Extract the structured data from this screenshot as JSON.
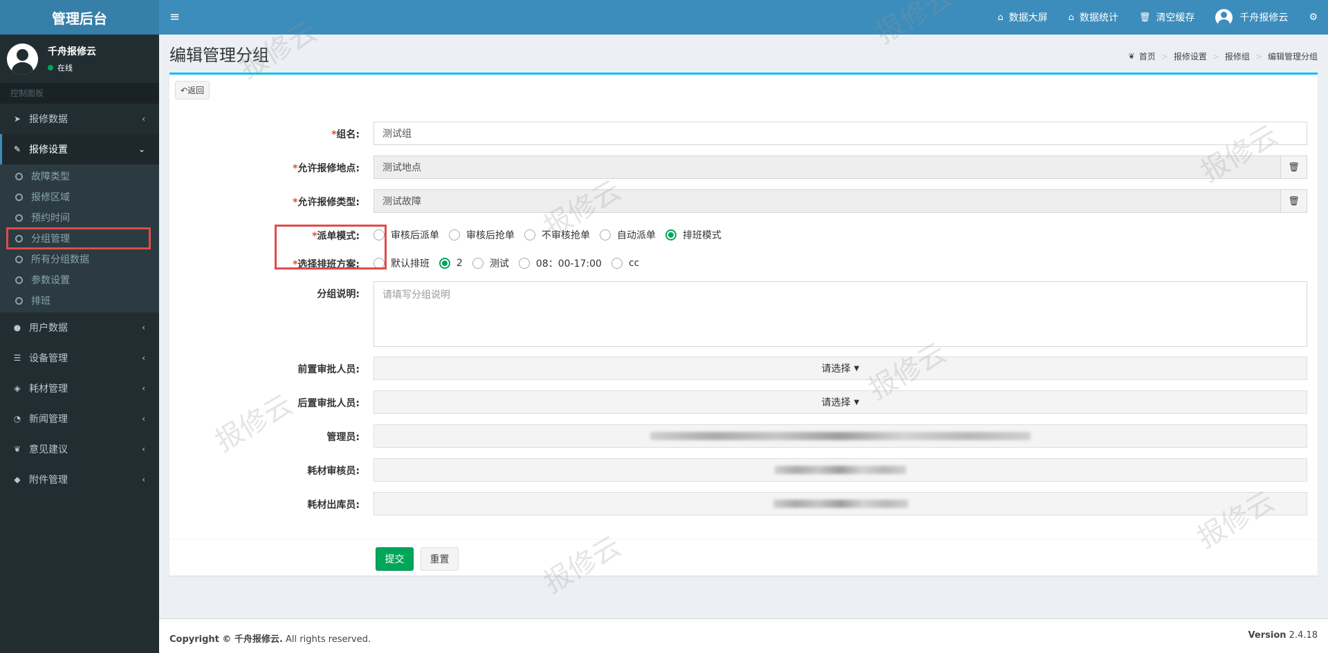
{
  "sidebar": {
    "logo": "管理后台",
    "user_name": "千舟报修云",
    "user_status": "在线",
    "section_header": "控制面板",
    "menu": {
      "repair_data": "报修数据",
      "repair_settings": "报修设置",
      "user_data": "用户数据",
      "device_mgmt": "设备管理",
      "material_mgmt": "耗材管理",
      "news_mgmt": "新闻管理",
      "feedback": "意见建议",
      "attachment_mgmt": "附件管理"
    },
    "submenu": {
      "fault_type": "故障类型",
      "repair_area": "报修区域",
      "appointment_time": "预约时间",
      "group_mgmt": "分组管理",
      "all_group_data": "所有分组数据",
      "param_settings": "参数设置",
      "scheduling": "排班"
    }
  },
  "topbar": {
    "menu_icon": "≡",
    "big_screen": "数据大屏",
    "statistics": "数据统计",
    "clear_cache": "清空缓存",
    "user_name": "千舟报修云"
  },
  "page": {
    "title": "编辑管理分组",
    "breadcrumb": {
      "home": "首页",
      "settings": "报修设置",
      "group": "报修组",
      "current": "编辑管理分组"
    }
  },
  "form": {
    "back_label": "返回",
    "required_mark": "*",
    "group_name_label": "组名:",
    "group_name_value": "测试组",
    "location_label": "允许报修地点:",
    "location_value": "测试地点",
    "type_label": "允许报修类型:",
    "type_value": "测试故障",
    "dispatch_label": "派单模式:",
    "dispatch_options": {
      "o1": "审核后派单",
      "o2": "审核后抢单",
      "o3": "不审核抢单",
      "o4": "自动派单",
      "o5": "排班模式"
    },
    "dispatch_selected": "排班模式",
    "schedule_label": "选择排班方案:",
    "schedule_options": {
      "o1": "默认排班",
      "o2": "2",
      "o3": "测试",
      "o4": "08：00-17:00",
      "o5": "cc"
    },
    "schedule_selected": "2",
    "desc_label": "分组说明:",
    "desc_placeholder": "请填写分组说明",
    "pre_approver_label": "前置审批人员:",
    "pre_approver_value": "请选择",
    "post_approver_label": "后置审批人员:",
    "post_approver_value": "请选择",
    "admin_label": "管理员:",
    "material_reviewer_label": "耗材审核员:",
    "material_outbound_label": "耗材出库员:",
    "submit_label": "提交",
    "reset_label": "重置"
  },
  "footer": {
    "copyright_prefix": "Copyright © 千舟报修云.",
    "copyright_suffix": " All rights reserved.",
    "version_label": "Version",
    "version_value": " 2.4.18"
  },
  "watermark": "报修云",
  "colors": {
    "header": "#3c8dbc",
    "sidebar": "#222d32",
    "success": "#00a65a",
    "highlight": "#e04b4b",
    "box_top": "#00c0ef"
  }
}
